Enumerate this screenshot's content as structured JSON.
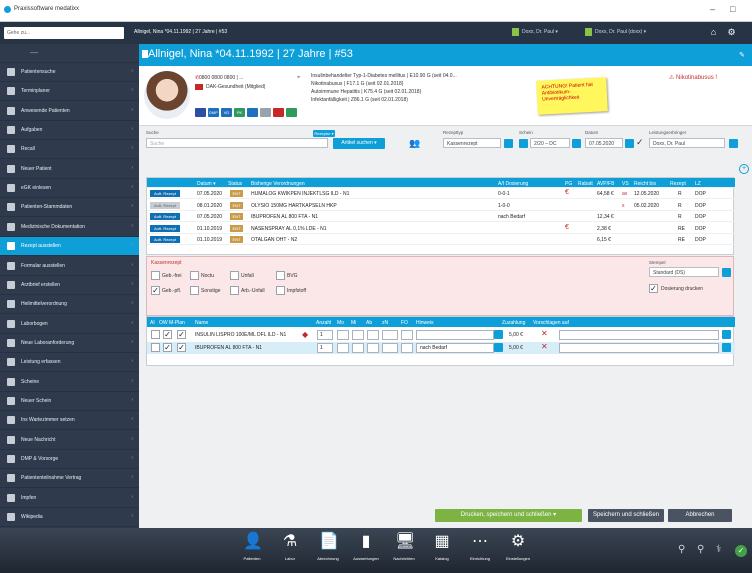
{
  "window": {
    "title": "Praxissoftware medatixx",
    "minimize": "–",
    "maximize": "□"
  },
  "topbar": {
    "goto_placeholder": "Gehe zu...",
    "patient": "Allnigel, Nina *04.11.1992 | 27 Jahre | #53",
    "doctor1": "Doxx, Dr. Paul ▾",
    "doctor2": "Doxx, Dr. Paul (doxx) ▾",
    "home_icon": "home-icon",
    "settings_icon": "gear-icon"
  },
  "sidebar": {
    "items": [
      {
        "label": "Patientensuche",
        "icon": "user-icon"
      },
      {
        "label": "Terminplaner",
        "icon": "calendar-icon"
      },
      {
        "label": "Anwesende Patienten",
        "icon": "people-icon"
      },
      {
        "label": "Aufgaben",
        "icon": "tasks-icon"
      },
      {
        "label": "Recall",
        "icon": "recall-icon"
      },
      {
        "label": "Neuer Patient",
        "icon": "add-user-icon"
      },
      {
        "label": "eGK einlesen",
        "icon": "card-icon"
      },
      {
        "label": "Patienten-Stammdaten",
        "icon": "user-card-icon"
      },
      {
        "label": "Medizinische Dokumentation",
        "icon": "document-icon"
      },
      {
        "label": "Rezept ausstellen",
        "icon": "prescription-icon"
      },
      {
        "label": "Formular ausstellen",
        "icon": "form-icon"
      },
      {
        "label": "Arztbrief erstellen",
        "icon": "letter-icon"
      },
      {
        "label": "Heilmittelverordnung",
        "icon": "therapy-icon"
      },
      {
        "label": "Laborbogen",
        "icon": "lab-icon"
      },
      {
        "label": "Neue Laboranforderung",
        "icon": "lab-request-icon"
      },
      {
        "label": "Leistung erfassen",
        "icon": "billing-icon"
      },
      {
        "label": "Scheine",
        "icon": "voucher-icon"
      },
      {
        "label": "Neuer Schein",
        "icon": "new-voucher-icon"
      },
      {
        "label": "Ins Wartezimmer setzen",
        "icon": "waiting-room-icon"
      },
      {
        "label": "Neue Nachricht",
        "icon": "message-icon"
      },
      {
        "label": "DMP & Vorsorge",
        "icon": "dmp-icon"
      },
      {
        "label": "Patiententeilnahme Vertrag",
        "icon": "contract-icon"
      },
      {
        "label": "Impfen",
        "icon": "vaccine-icon"
      },
      {
        "label": "Wikipedia",
        "icon": "wikipedia-icon"
      }
    ]
  },
  "patient": {
    "title": "Allnigel, Nina *04.11.1992 | 27 Jahre | #53",
    "phone": "0800 0800 0800 | ...",
    "insurance": "DAK-Gesundheit (Mitglied)",
    "diagnoses": [
      "Insulinbehandelter Typ-1-Diabetes mellitus | E10.90 G (seit 04.0...",
      "Nikotinabusus | F17.1 G (seit 02.01.2018)",
      "Autoimmune Hepatitis | K75.4 G (seit 02.01.2018)",
      "Infektanfälligkeit | Z86.1 G (seit 02.01.2018)"
    ],
    "sticky": "ACHTUNG! Patient hat Antibiotikum-Unverträglichkeit",
    "warning": "Nikotinabusus !",
    "chips": [
      "V1",
      "DMP",
      "VD",
      "PK",
      "",
      ""
    ]
  },
  "search": {
    "label": "Suche",
    "placeholder": "Suche",
    "dropdown": "Rezeptur ▾",
    "button": "Artikel suchen ▾"
  },
  "rezepttyp": {
    "label": "Rezepttyp",
    "value": "Kassenrezept"
  },
  "schein": {
    "label": "Schein",
    "value": "2/20 – DC"
  },
  "datum": {
    "label": "Datum",
    "value": "07.05.2020"
  },
  "arzt": {
    "label": "Leistungserbringer",
    "value": "Doxx, Dr. Paul"
  },
  "history": {
    "headers": {
      "datum": "Datum ▾",
      "status": "Status",
      "bisherige": "Bisherige Verordnungen",
      "aidem": "A/I Dosierung",
      "pg": "PG",
      "rabatt": "Rabatt",
      "avp": "AVP/FB",
      "vs": "VS",
      "reicht": "Reicht bis",
      "rezept": "Rezept",
      "lz": "LZ"
    },
    "rows": [
      {
        "badge": "Auft. Rezept",
        "date": "07.05.2020",
        "status": "ENT",
        "name": "HUMALOG KWIKPEN INJEKTLSG ILD - N1",
        "dose": "0-0-1",
        "price": "64,58 €",
        "vs": "av",
        "bis": "12.05.2020",
        "r": "R",
        "lz": "DOP"
      },
      {
        "badge": "Auft. Rezept",
        "date": "08.01.2020",
        "status": "ENT",
        "name": "OLYSIO 150MG HARTKAPSELN HKP",
        "dose": "1-0-0",
        "price": "",
        "vs": "x",
        "bis": "05.02.2020",
        "r": "R",
        "lz": "DOP"
      },
      {
        "badge": "Auft. Rezept",
        "date": "07.05.2020",
        "status": "ENT",
        "name": "IBUPROFEN AL 800 FTA - N1",
        "dose": "nach Bedarf",
        "price": "12,34 €",
        "vs": "",
        "bis": "",
        "r": "R",
        "lz": "DOP"
      },
      {
        "badge": "Auft. Rezept",
        "date": "01.10.2019",
        "status": "ENT",
        "name": "NASENSPRAY AL 0,1% LDE - N1",
        "dose": "",
        "price": "2,38 €",
        "vs": "",
        "bis": "",
        "r": "RE",
        "lz": "DOP"
      },
      {
        "badge": "Auft. Rezept",
        "date": "01.10.2019",
        "status": "ENT",
        "name": "OTALGAN OHT - N2",
        "dose": "",
        "price": "6,15 €",
        "vs": "",
        "bis": "",
        "r": "RE",
        "lz": "DOP"
      }
    ]
  },
  "rezept": {
    "title": "Kassenrezept",
    "checks": [
      "Geb.-frei",
      "Noctu",
      "Unfall",
      "BVG",
      "Geb.-pfl.",
      "Sonstige",
      "Arb.-Unfall",
      "Impfstoff"
    ],
    "stempel_label": "Stempel",
    "stempel_value": "Standard (DS)",
    "dosierung_label": "Dosierung drucken"
  },
  "medtable": {
    "headers": [
      "AI",
      "OW",
      "M-Plan",
      "Name",
      "Anzahl",
      "Mo",
      "Mi",
      "Ab",
      "zN",
      "FO",
      "Hinweis",
      "Zuzahlung",
      "Vorschlagen auf"
    ],
    "rows": [
      {
        "name": "INSULIN LISPRO 100E/ML DFL ILD - N1",
        "amount": "1",
        "hint": "",
        "price": "5,00 €"
      },
      {
        "name": "IBUPROFEN AL 800 FTA - N1",
        "amount": "1",
        "hint": "nach Bedarf",
        "price": "5,00 €"
      }
    ]
  },
  "footer": {
    "print": "Drucken, speichern und schließen ▾",
    "save": "Speichern und schließen",
    "cancel": "Abbrechen"
  },
  "dock": [
    {
      "label": "Patienten",
      "icon": "patients-icon"
    },
    {
      "label": "Labor",
      "icon": "lab-icon"
    },
    {
      "label": "Abrechnung",
      "icon": "billing-icon"
    },
    {
      "label": "Auswertungen",
      "icon": "chart-icon"
    },
    {
      "label": "Nachrichten",
      "icon": "messages-icon"
    },
    {
      "label": "Katalog",
      "icon": "catalog-icon"
    },
    {
      "label": "Einrichtung",
      "icon": "setup-icon"
    },
    {
      "label": "Einstellungen",
      "icon": "settings-icon"
    }
  ]
}
